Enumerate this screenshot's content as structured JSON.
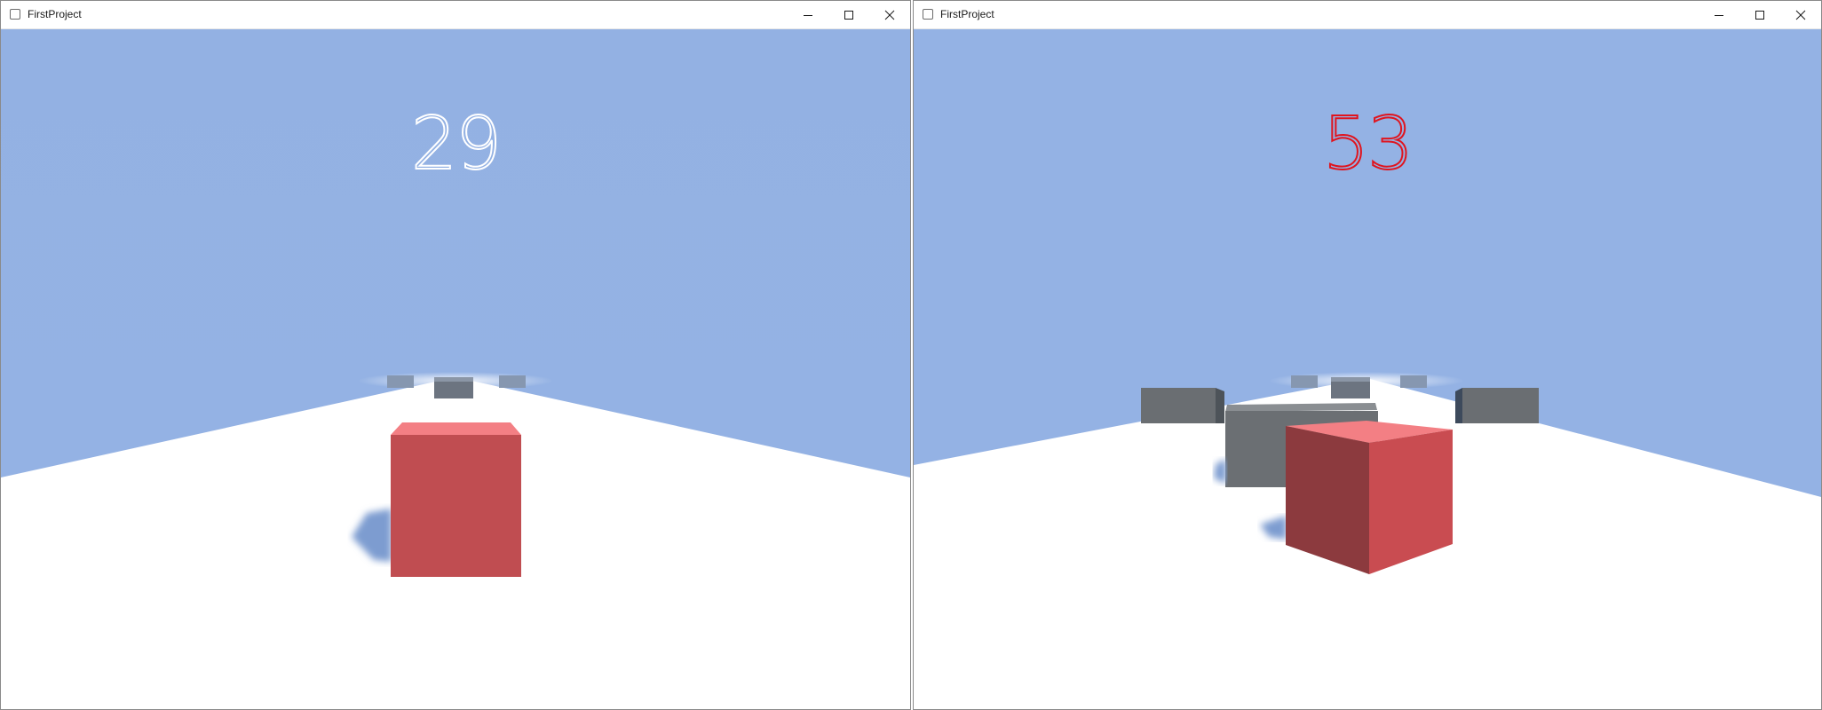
{
  "windows": [
    {
      "title": "FirstProject",
      "score": "29",
      "score_color": "#ffffff",
      "controls": {
        "minimize": "minimize-icon",
        "maximize": "maximize-icon",
        "close": "close-icon"
      }
    },
    {
      "title": "FirstProject",
      "score": "53",
      "score_color": "#e0141e",
      "controls": {
        "minimize": "minimize-icon",
        "maximize": "maximize-icon",
        "close": "close-icon"
      }
    }
  ],
  "colors": {
    "sky": "#94b2e4",
    "ground": "#ffffff",
    "player_cube": "#c44d51",
    "obstacle": "#6b7074",
    "shadow": "#7d9cd0"
  }
}
